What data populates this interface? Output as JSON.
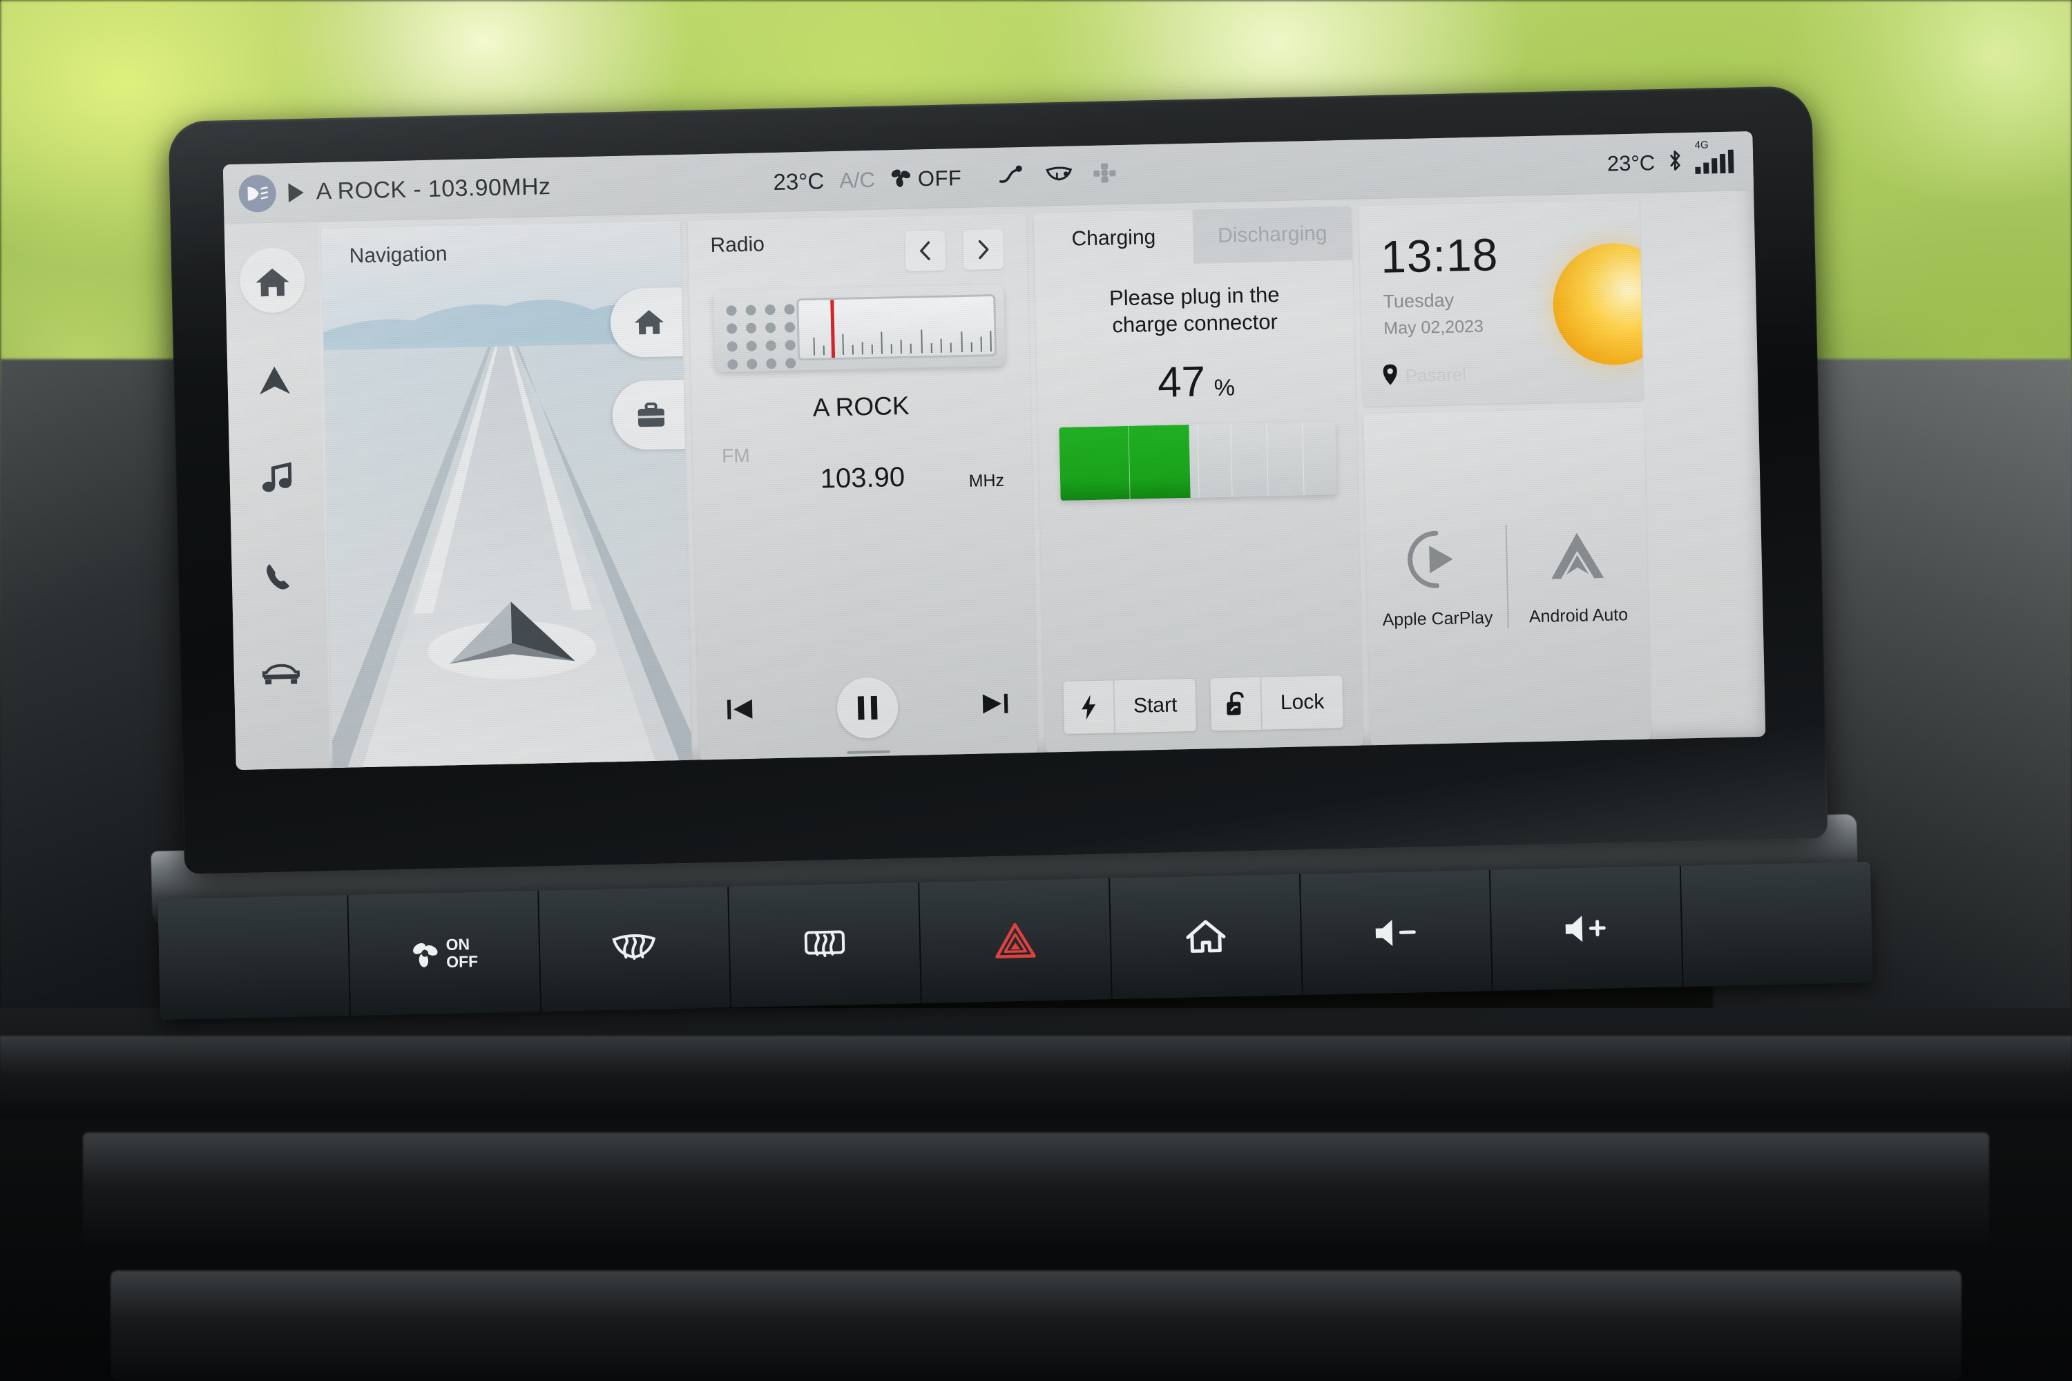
{
  "statusbar": {
    "fog_light_icon": "fog-light-icon",
    "play_icon": "play-icon",
    "now_playing": "A ROCK - 103.90MHz",
    "cabin_temp": "23°C",
    "ac_label": "A/C",
    "fan_icon": "fan-icon",
    "fan_state": "OFF",
    "airflow_icon": "airflow-face-icon",
    "defrost_icon": "windshield-defrost-icon",
    "seat_icon": "seat-climate-icon",
    "outside_temp": "23°C",
    "bluetooth_icon": "bluetooth-icon",
    "network_label": "4G",
    "signal_icon": "signal-bars-icon"
  },
  "sidebar": {
    "items": [
      {
        "name": "home",
        "icon": "home-icon",
        "active": true
      },
      {
        "name": "navigation",
        "icon": "navigation-arrow-icon",
        "active": false
      },
      {
        "name": "media",
        "icon": "music-note-icon",
        "active": false
      },
      {
        "name": "phone",
        "icon": "phone-icon",
        "active": false
      },
      {
        "name": "vehicle",
        "icon": "car-icon",
        "active": false
      }
    ]
  },
  "navigation_card": {
    "title": "Navigation",
    "home_shortcut_icon": "home-icon",
    "work_shortcut_icon": "briefcase-icon",
    "vehicle_position_icon": "vehicle-chevron-icon"
  },
  "radio_card": {
    "title": "Radio",
    "prev_preset_icon": "chevron-left-icon",
    "next_preset_icon": "chevron-right-icon",
    "dial_icon": "radio-dial-icon",
    "station": "A ROCK",
    "band": "FM",
    "frequency": "103.90",
    "frequency_unit": "MHz",
    "prev_icon": "skip-previous-icon",
    "play_pause_icon": "pause-icon",
    "next_icon": "skip-next-icon"
  },
  "charge_card": {
    "tabs": [
      {
        "label": "Charging",
        "active": true
      },
      {
        "label": "Discharging",
        "active": false
      }
    ],
    "message_line1": "Please plug in the",
    "message_line2": "charge connector",
    "battery_percent": "47",
    "percent_sign": "%",
    "battery_level": 47,
    "fill_color": "#1aa81c",
    "start_button": {
      "label": "Start",
      "icon": "lightning-bolt-icon"
    },
    "lock_button": {
      "label": "Lock",
      "icon": "unlock-padlock-icon"
    }
  },
  "clock_card": {
    "time": "13:18",
    "weekday": "Tuesday",
    "date": "May 02,2023",
    "location_icon": "location-pin-icon",
    "location": "Pasarel",
    "weather_icon": "sunny-icon"
  },
  "projection_card": {
    "carplay": {
      "label": "Apple CarPlay",
      "icon": "apple-carplay-icon"
    },
    "android_auto": {
      "label": "Android Auto",
      "icon": "android-auto-icon"
    }
  },
  "hardware_buttons": [
    {
      "name": "blank-left",
      "icon": "blank",
      "label": ""
    },
    {
      "name": "fan-on-off",
      "icon": "fan-icon",
      "label_line1": "ON",
      "label_line2": "OFF"
    },
    {
      "name": "front-defrost",
      "icon": "windshield-defrost-icon",
      "label": ""
    },
    {
      "name": "rear-defrost",
      "icon": "rear-defrost-icon",
      "label": ""
    },
    {
      "name": "hazard-lights",
      "icon": "hazard-triangle-icon",
      "label": ""
    },
    {
      "name": "home",
      "icon": "home-outline-icon",
      "label": ""
    },
    {
      "name": "volume-down",
      "icon": "volume-down-icon",
      "label": ""
    },
    {
      "name": "volume-up",
      "icon": "volume-up-icon",
      "label": ""
    },
    {
      "name": "blank-right",
      "icon": "blank",
      "label": ""
    }
  ],
  "colors": {
    "accent_green": "#1aa81c",
    "hazard_red": "#e0413c",
    "screen_bg": "#dddfe0",
    "fog_badge": "#7d8aa3"
  }
}
